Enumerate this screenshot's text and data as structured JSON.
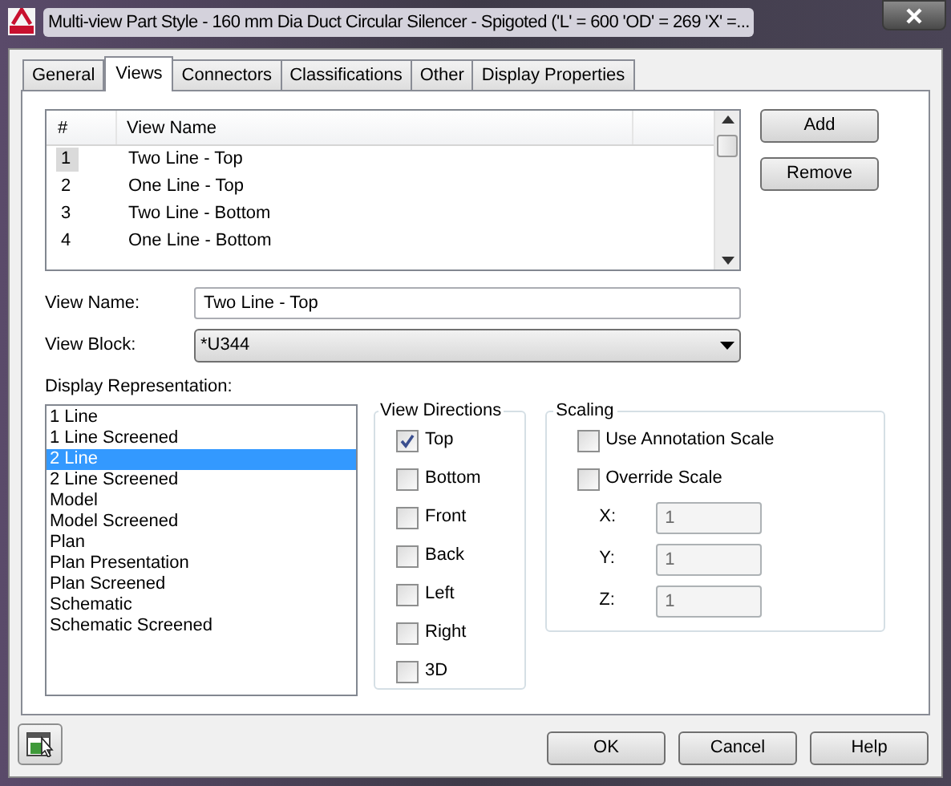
{
  "window": {
    "title": "Multi-view Part Style - 160 mm Dia Duct Circular Silencer - Spigoted ('L' = 600 'OD' = 269 'X' =..."
  },
  "tabs": [
    {
      "label": "General",
      "selected": false
    },
    {
      "label": "Views",
      "selected": true
    },
    {
      "label": "Connectors",
      "selected": false
    },
    {
      "label": "Classifications",
      "selected": false
    },
    {
      "label": "Other",
      "selected": false
    },
    {
      "label": "Display Properties",
      "selected": false
    }
  ],
  "views_table": {
    "columns": [
      "#",
      "View Name"
    ],
    "rows": [
      {
        "number": "1",
        "name": "Two Line - Top",
        "selected": true
      },
      {
        "number": "2",
        "name": "One Line - Top",
        "selected": false
      },
      {
        "number": "3",
        "name": "Two Line - Bottom",
        "selected": false
      },
      {
        "number": "4",
        "name": "One Line - Bottom",
        "selected": false
      }
    ]
  },
  "side_buttons": [
    "Add",
    "Remove"
  ],
  "view_name": {
    "label": "View Name:",
    "value": "Two Line - Top"
  },
  "view_block": {
    "label": "View Block:",
    "value": "*U344"
  },
  "display_representation": {
    "label": "Display Representation:",
    "items": [
      {
        "label": "1 Line",
        "selected": false
      },
      {
        "label": "1 Line Screened",
        "selected": false
      },
      {
        "label": "2 Line",
        "selected": true
      },
      {
        "label": "2 Line Screened",
        "selected": false
      },
      {
        "label": "Model",
        "selected": false
      },
      {
        "label": "Model Screened",
        "selected": false
      },
      {
        "label": "Plan",
        "selected": false
      },
      {
        "label": "Plan Presentation",
        "selected": false
      },
      {
        "label": "Plan Screened",
        "selected": false
      },
      {
        "label": "Schematic",
        "selected": false
      },
      {
        "label": "Schematic Screened",
        "selected": false
      }
    ]
  },
  "view_directions": {
    "title": "View Directions",
    "options": [
      {
        "label": "Top",
        "checked": true
      },
      {
        "label": "Bottom",
        "checked": false
      },
      {
        "label": "Front",
        "checked": false
      },
      {
        "label": "Back",
        "checked": false
      },
      {
        "label": "Left",
        "checked": false
      },
      {
        "label": "Right",
        "checked": false
      },
      {
        "label": "3D",
        "checked": false
      }
    ]
  },
  "scaling": {
    "title": "Scaling",
    "options": [
      {
        "label": "Use Annotation Scale",
        "checked": false
      },
      {
        "label": "Override Scale",
        "checked": false
      }
    ],
    "fields": [
      {
        "label": "X:",
        "value": "1",
        "disabled": true
      },
      {
        "label": "Y:",
        "value": "1",
        "disabled": true
      },
      {
        "label": "Z:",
        "value": "1",
        "disabled": true
      }
    ]
  },
  "footer_buttons": [
    "OK",
    "Cancel",
    "Help"
  ]
}
